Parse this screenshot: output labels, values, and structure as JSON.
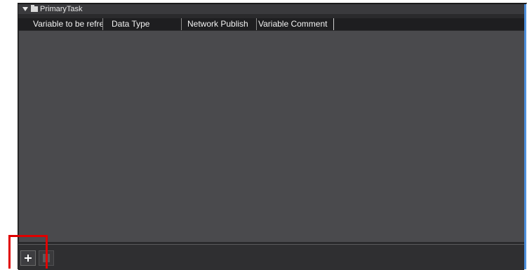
{
  "group": {
    "label": "PrimaryTask",
    "expanded": true
  },
  "columns": [
    {
      "label": "Variable to be refre"
    },
    {
      "label": "Data Type"
    },
    {
      "label": "Network Publish"
    },
    {
      "label": "Variable Comment"
    }
  ],
  "colors": {
    "panel_bg": "#4a4a4d",
    "header_bg": "#1e1e20",
    "accent_edge": "#4d8fdc",
    "highlight": "#e00000"
  },
  "toolbar": {
    "add_icon": "plus-icon",
    "delete_icon": "doc-icon"
  }
}
